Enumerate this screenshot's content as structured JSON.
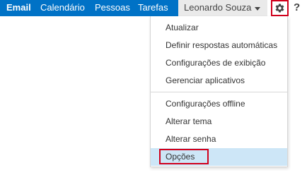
{
  "nav": {
    "email": "Email",
    "calendar": "Calendário",
    "people": "Pessoas",
    "tasks": "Tarefas"
  },
  "user": {
    "name": "Leonardo Souza",
    "menu_icon": "caret-down-icon"
  },
  "toolbar": {
    "settings_icon": "gear-icon",
    "help_label": "?"
  },
  "settings_menu": {
    "items": [
      {
        "label": "Atualizar"
      },
      {
        "label": "Definir respostas automáticas"
      },
      {
        "label": "Configurações de exibição"
      },
      {
        "label": "Gerenciar aplicativos"
      },
      {
        "label": "Configurações offline"
      },
      {
        "label": "Alterar tema"
      },
      {
        "label": "Alterar senha"
      },
      {
        "label": "Opções",
        "selected": true
      }
    ]
  },
  "colors": {
    "brand_blue": "#0072c6",
    "highlight_red": "#d1001c",
    "selected_bg": "#cde6f7"
  }
}
